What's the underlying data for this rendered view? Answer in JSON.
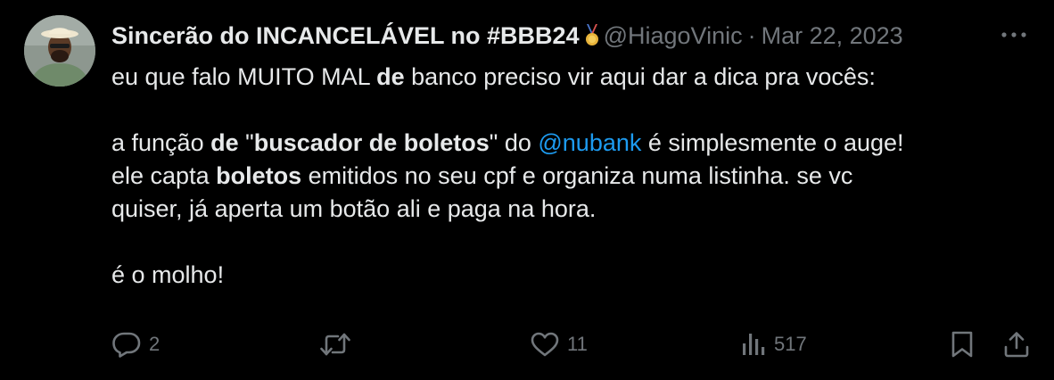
{
  "author": {
    "display_name": "Sincerão do INCANCELÁVEL no #BBB24",
    "badge_icon": "medal-emoji-icon",
    "handle": "@HiagoVinic",
    "separator": "·",
    "date": "Mar 22, 2023"
  },
  "tweet": {
    "line1": {
      "t1": "eu que falo MUITO MAL ",
      "b1": "de",
      "t2": " banco preciso vir aqui dar a dica pra vocês:"
    },
    "line2": {
      "t1": "a função ",
      "b1": "de",
      "t2": " \"",
      "b2": "buscador de boletos",
      "t3": "\" do ",
      "mention": "@nubank",
      "t4": " é simplesmente o auge!"
    },
    "line3": {
      "t1": "ele capta ",
      "b1": "boletos",
      "t2": " emitidos no seu cpf e organiza numa listinha. se vc"
    },
    "line4": {
      "t1": "quiser, já aperta um botão ali e paga na hora."
    },
    "line5": {
      "t1": "é o molho!"
    }
  },
  "actions": {
    "replies": "2",
    "retweets": "",
    "likes": "11",
    "views": "517"
  },
  "colors": {
    "background": "#000000",
    "text": "#e7e9ea",
    "secondary": "#71767b",
    "link": "#1d9bf0"
  }
}
